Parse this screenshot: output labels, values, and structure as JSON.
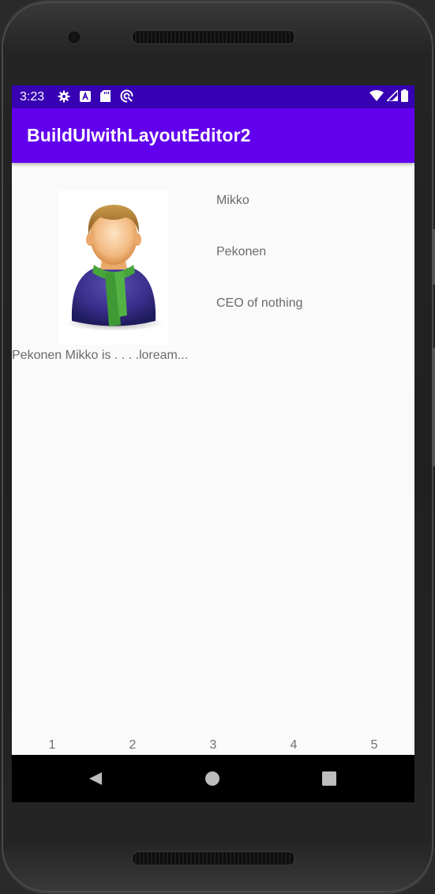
{
  "status_bar": {
    "time": "3:23",
    "left_icons": [
      "gear-icon",
      "a-icon",
      "sd-card-icon",
      "sync-icon"
    ],
    "right_icons": [
      "wifi-icon",
      "signal-icon",
      "battery-icon"
    ]
  },
  "app_bar": {
    "title": "BuildUIwithLayoutEditor2"
  },
  "profile": {
    "avatar_icon": "person-avatar-icon",
    "first_name": "Mikko",
    "last_name": "Pekonen",
    "title": "CEO of nothing",
    "bio": "Pekonen Mikko is . . . .loream..."
  },
  "tabs": [
    "1",
    "2",
    "3",
    "4",
    "5"
  ],
  "nav_bar": {
    "buttons": [
      "back-icon",
      "home-icon",
      "recents-icon"
    ]
  },
  "colors": {
    "status_bar": "#3700b3",
    "app_bar": "#6200ee",
    "background": "#fafafa",
    "text": "#6b6b6b"
  }
}
